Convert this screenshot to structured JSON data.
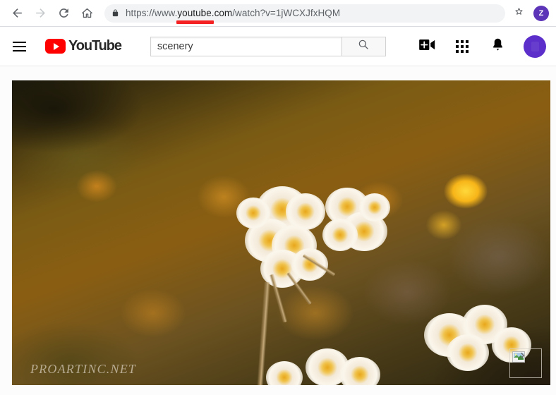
{
  "browser": {
    "back_icon": "back-arrow-icon",
    "forward_icon": "forward-arrow-icon",
    "reload_icon": "reload-icon",
    "home_icon": "home-icon",
    "lock_icon": "lock-icon",
    "url_scheme": "https://www.",
    "url_host": "youtube.com",
    "url_path": "/watch?v=1jWCXJfxHQM",
    "url_full": "https://www.youtube.com/watch?v=1jWCXJfxHQM",
    "star_icon": "star-icon",
    "profile_initial": "Z",
    "profile_color": "#5c34b8",
    "highlight_color": "#f42222"
  },
  "youtube": {
    "menu_icon": "hamburger-menu-icon",
    "logo_text": "YouTube",
    "logo_color": "#ff0000",
    "search": {
      "value": "scenery",
      "placeholder": "Search",
      "button_icon": "search-icon"
    },
    "actions": [
      {
        "name": "create-video-icon",
        "label": "Create"
      },
      {
        "name": "apps-grid-icon",
        "label": "YouTube apps"
      },
      {
        "name": "notifications-bell-icon",
        "label": "Notifications"
      },
      {
        "name": "avatar",
        "label": "Account"
      }
    ],
    "avatar_color": "#5c2fcb"
  },
  "content": {
    "photo_alt": "Blurred bokeh photo of white dried flowers with yellow centers",
    "watermark": "PROARTINC.NET",
    "broken_image_icon": "broken-image-icon"
  }
}
